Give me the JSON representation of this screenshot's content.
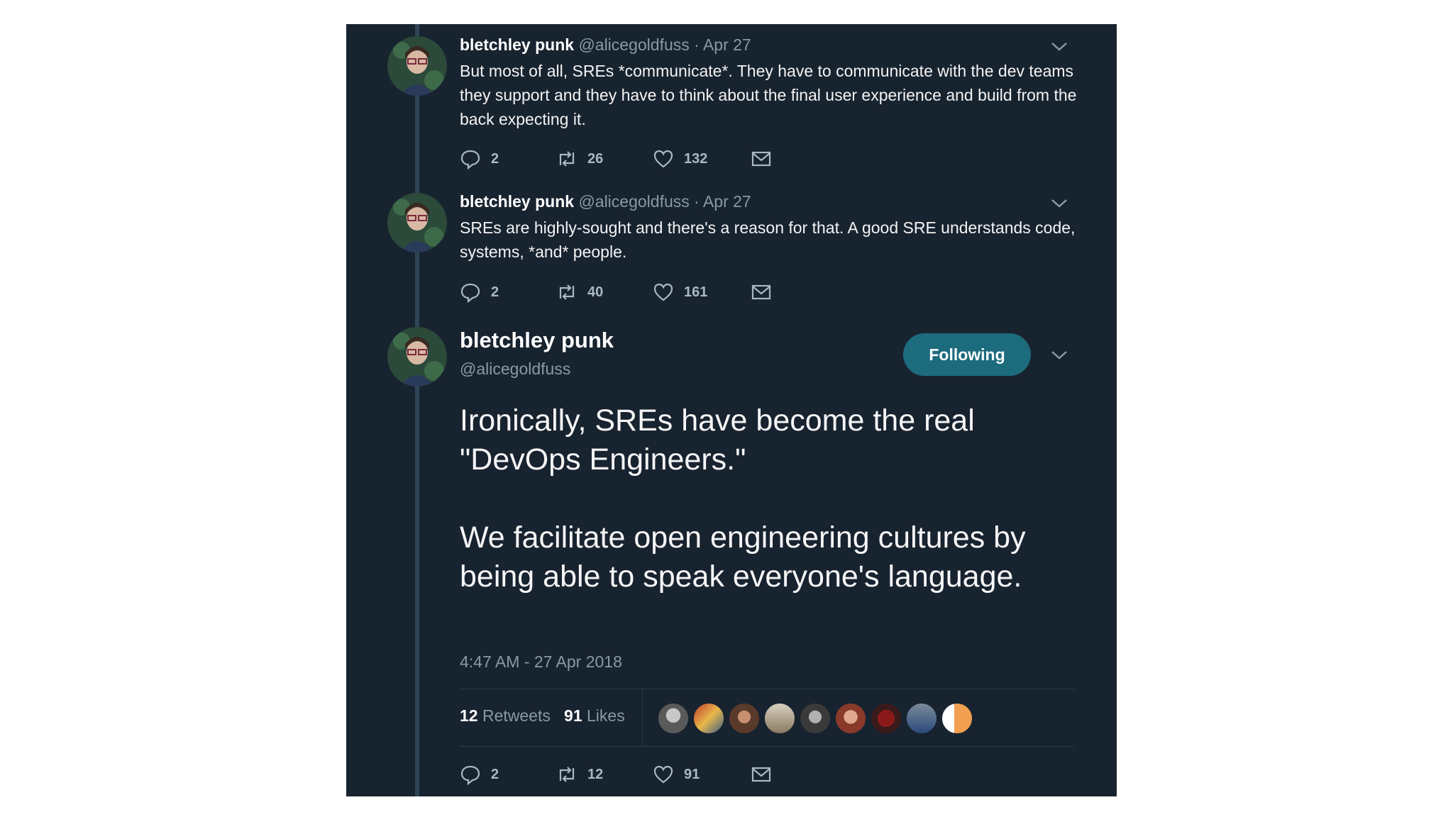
{
  "tweets": [
    {
      "name": "bletchley punk",
      "handle": "@alicegoldfuss",
      "date": "· Apr 27",
      "text": "But most of all, SREs *communicate*. They have to communicate with the dev teams they support and they have to think about the final user experience and build from the back expecting it.",
      "replies": "2",
      "retweets": "26",
      "likes": "132"
    },
    {
      "name": "bletchley punk",
      "handle": "@alicegoldfuss",
      "date": "· Apr 27",
      "text": "SREs are highly-sought and there's a reason for that. A good SRE understands code, systems, *and* people.",
      "replies": "2",
      "retweets": "40",
      "likes": "161"
    }
  ],
  "main": {
    "name": "bletchley punk",
    "handle": "@alicegoldfuss",
    "follow_label": "Following",
    "text": "Ironically, SREs have become the real \"DevOps Engineers.\"\n\nWe facilitate open engineering cultures by being able to speak everyone's language.",
    "timestamp": "4:47 AM - 27 Apr 2018",
    "retweets_count": "12",
    "retweets_label": "Retweets",
    "likes_count": "91",
    "likes_label": "Likes",
    "replies": "2",
    "retweets": "12",
    "likes": "91"
  },
  "icons": [
    "reply-icon",
    "retweet-icon",
    "like-icon",
    "message-icon",
    "chevron-down-icon"
  ],
  "colors": {
    "background": "#182330",
    "accent": "#1d6c7e",
    "text": "#f3f3f3",
    "muted": "#8899a6"
  }
}
